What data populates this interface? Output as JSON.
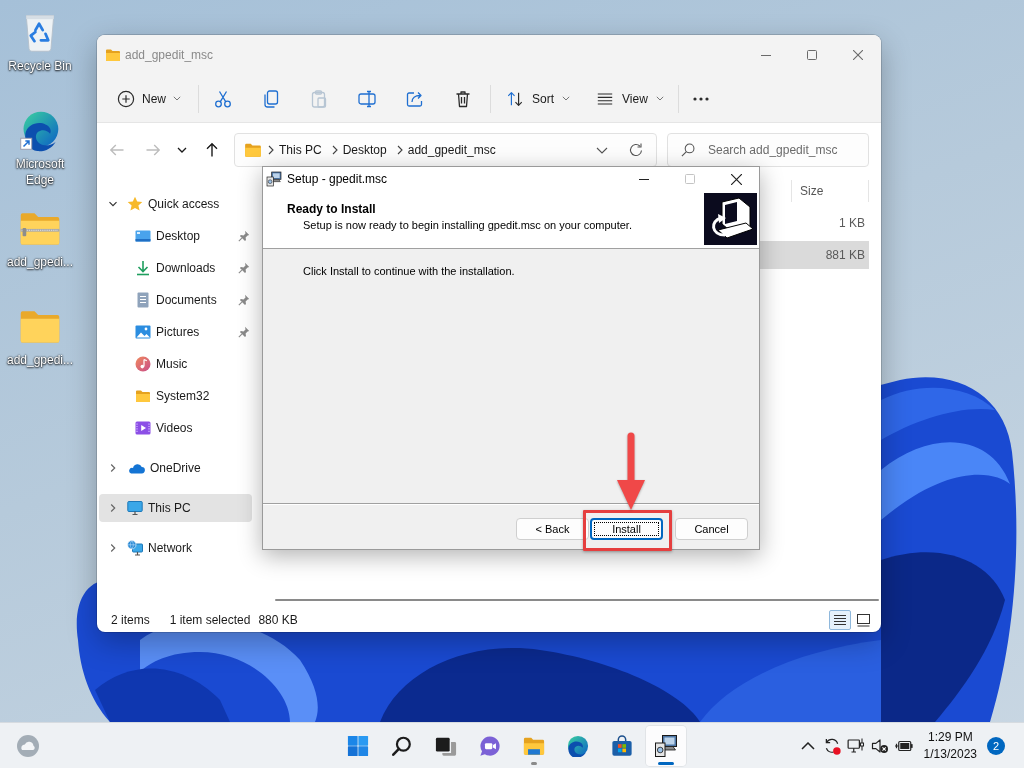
{
  "desktop": {
    "icons": [
      {
        "kind": "recycle",
        "label": "Recycle Bin"
      },
      {
        "kind": "browser",
        "label": "Microsoft Edge"
      },
      {
        "kind": "zip",
        "label": "add_gpedi..."
      },
      {
        "kind": "folder",
        "label": "add_gpedi..."
      }
    ]
  },
  "explorer": {
    "title": "add_gpedit_msc",
    "active": false,
    "toolbar": [
      {
        "kind": "new",
        "label": "New",
        "disabled": false
      },
      {
        "kind": "cut",
        "disabled": false
      },
      {
        "kind": "copy",
        "disabled": false
      },
      {
        "kind": "paste",
        "disabled": true
      },
      {
        "kind": "rename",
        "disabled": false
      },
      {
        "kind": "share",
        "disabled": false
      },
      {
        "kind": "delete",
        "disabled": false
      },
      {
        "kind": "sort",
        "label": "Sort",
        "disabled": false
      },
      {
        "kind": "view",
        "label": "View",
        "disabled": false
      },
      {
        "kind": "more",
        "disabled": false
      }
    ],
    "nav": [
      {
        "kind": "back",
        "disabled": true
      },
      {
        "kind": "forward",
        "disabled": true
      },
      {
        "kind": "recent",
        "disabled": false
      },
      {
        "kind": "up",
        "disabled": false
      }
    ],
    "address": {
      "path": [
        "This PC",
        "Desktop",
        "add_gpedit_msc"
      ]
    },
    "search": {
      "placeholder": "Search add_gpedit_msc"
    },
    "sidebar": {
      "items": [
        {
          "kind": "star",
          "label": "Quick access",
          "expanded": true,
          "selected": false,
          "children": [
            {
              "kind": "desktop",
              "label": "Desktop",
              "pinned": true,
              "selected": false
            },
            {
              "kind": "downloads",
              "label": "Downloads",
              "pinned": true,
              "selected": false
            },
            {
              "kind": "documents",
              "label": "Documents",
              "pinned": true,
              "selected": false
            },
            {
              "kind": "pictures",
              "label": "Pictures",
              "pinned": true,
              "selected": false
            },
            {
              "kind": "music",
              "label": "Music",
              "pinned": false,
              "selected": false
            },
            {
              "kind": "folder",
              "label": "System32",
              "pinned": false,
              "selected": false
            },
            {
              "kind": "videos",
              "label": "Videos",
              "pinned": false,
              "selected": false
            }
          ]
        },
        {
          "kind": "cloud",
          "label": "OneDrive",
          "expanded": false,
          "selected": false
        },
        {
          "kind": "pc",
          "label": "This PC",
          "expanded": false,
          "selected": true
        },
        {
          "kind": "network",
          "label": "Network",
          "expanded": false,
          "selected": false
        }
      ]
    },
    "file_list": {
      "columns": [
        "Size"
      ],
      "rows": [
        {
          "size": "1 KB",
          "selected": false
        },
        {
          "size": "881 KB",
          "selected": true
        }
      ]
    },
    "status_bar": {
      "item_count": "2 items",
      "selection": "1 item selected",
      "selection_size": "880 KB",
      "views": [
        {
          "kind": "details",
          "selected": true
        },
        {
          "kind": "tiles",
          "selected": false
        }
      ]
    }
  },
  "dialog": {
    "title": "Setup - gpedit.msc",
    "heading": "Ready to Install",
    "description": "Setup is now ready to begin installing gpedit.msc on your computer.",
    "message": "Click Install to continue with the installation.",
    "buttons": [
      {
        "label": "< Back",
        "focused": false,
        "highlighted": false
      },
      {
        "label": "Install",
        "focused": true,
        "highlighted": true
      },
      {
        "label": "Cancel",
        "focused": false,
        "highlighted": false
      }
    ]
  },
  "taskbar": {
    "apps": [
      {
        "kind": "start",
        "running": false,
        "active": false
      },
      {
        "kind": "search",
        "running": false,
        "active": false
      },
      {
        "kind": "taskview",
        "running": false,
        "active": false
      },
      {
        "kind": "chat",
        "running": false,
        "active": false
      },
      {
        "kind": "explorer",
        "running": true,
        "active": false
      },
      {
        "kind": "browser",
        "running": false,
        "active": false
      },
      {
        "kind": "store",
        "running": false,
        "active": false
      },
      {
        "kind": "setup",
        "running": true,
        "active": true
      }
    ],
    "tray": [
      {
        "kind": "chevron"
      },
      {
        "kind": "sync"
      },
      {
        "kind": "network"
      },
      {
        "kind": "volume"
      },
      {
        "kind": "power"
      }
    ],
    "time": "1:29 PM",
    "date": "1/13/2023",
    "notifications": "2"
  }
}
